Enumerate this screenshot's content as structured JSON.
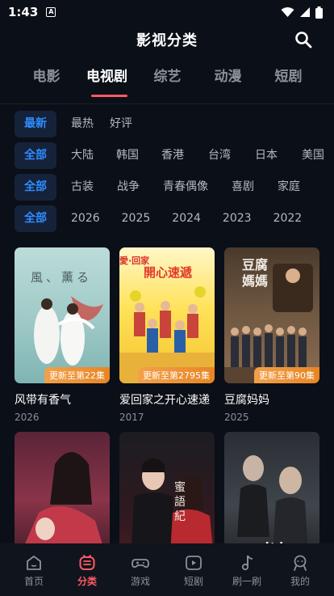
{
  "status": {
    "time": "1:43",
    "notification": "A"
  },
  "header": {
    "title": "影视分类"
  },
  "tabs": [
    {
      "label": "电影",
      "active": false
    },
    {
      "label": "电视剧",
      "active": true
    },
    {
      "label": "综艺",
      "active": false
    },
    {
      "label": "动漫",
      "active": false
    },
    {
      "label": "短剧",
      "active": false
    }
  ],
  "filters": {
    "sort": [
      "最新",
      "最热",
      "好评"
    ],
    "region": [
      "全部",
      "大陆",
      "韩国",
      "香港",
      "台湾",
      "日本",
      "美国"
    ],
    "genre": [
      "全部",
      "古装",
      "战争",
      "青春偶像",
      "喜剧",
      "家庭"
    ],
    "year": [
      "全部",
      "2026",
      "2025",
      "2024",
      "2023",
      "2022"
    ]
  },
  "cards": [
    {
      "title": "风带有香气",
      "year": "2026",
      "badge": "更新至第22集"
    },
    {
      "title": "爱回家之开心速递",
      "year": "2017",
      "badge": "更新至第2795集"
    },
    {
      "title": "豆腐妈妈",
      "year": "2025",
      "badge": "更新至第90集"
    },
    {
      "title": "",
      "year": "",
      "badge": ""
    },
    {
      "title": "",
      "year": "",
      "badge": ""
    },
    {
      "title": "",
      "year": "",
      "badge": ""
    }
  ],
  "poster_text": {
    "p1": "風、薰る",
    "p2": "開心速遞",
    "p2_top": "愛·回家",
    "p3": "豆腐媽媽",
    "p5": "蜜語紀",
    "p6": "对决"
  },
  "bottom_nav": [
    {
      "label": "首页",
      "icon": "home-icon",
      "active": false
    },
    {
      "label": "分类",
      "icon": "category-icon",
      "active": true
    },
    {
      "label": "游戏",
      "icon": "gamepad-icon",
      "active": false
    },
    {
      "label": "短剧",
      "icon": "play-box-icon",
      "active": false
    },
    {
      "label": "刷一刷",
      "icon": "music-note-icon",
      "active": false
    },
    {
      "label": "我的",
      "icon": "profile-icon",
      "active": false
    }
  ],
  "colors": {
    "accent": "#ff5a66",
    "chip_active": "#2f8cff",
    "badge": "#e88524",
    "background": "#0b0f17"
  }
}
